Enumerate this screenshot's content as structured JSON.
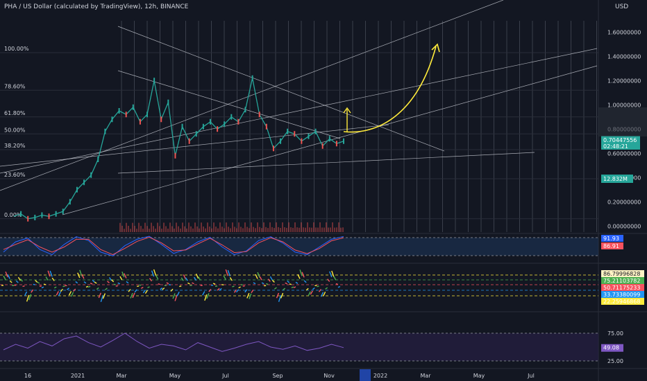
{
  "header": {
    "title": "PHA / US Dollar (calculated by TradingView), 12h, BINANCE",
    "currency": "USD"
  },
  "colors": {
    "background": "#131722",
    "grid": "#2a2e39",
    "fib_lines": "#b2b5be",
    "channel_lines": "#cfd2da",
    "projection": "#ffeb3b",
    "price_badge": "#26a69a",
    "volume_badge": "#26a69a",
    "stoch_k": "#2962ff",
    "stoch_d": "#f7525f",
    "rsi": "#7e57c2"
  },
  "chart_data": [
    {
      "type": "line",
      "panel": "price",
      "y_axis_ticks": [
        "1.60000000",
        "1.40000000",
        "1.20000000",
        "1.00000000",
        "0.80000000",
        "0.60000000",
        "0.40000000",
        "0.20000000",
        "0.00000000"
      ],
      "ylim": [
        -0.05,
        1.75
      ],
      "fib_levels": [
        {
          "label": "100.00%",
          "value": 1.43
        },
        {
          "label": "78.60%",
          "value": 1.12
        },
        {
          "label": "61.80%",
          "value": 0.9
        },
        {
          "label": "50.00%",
          "value": 0.76
        },
        {
          "label": "38.20%",
          "value": 0.63
        },
        {
          "label": "23.60%",
          "value": 0.39
        },
        {
          "label": "0.00%",
          "value": 0.06
        }
      ],
      "x_axis_labels": [
        "16",
        "2021",
        "Mar",
        "May",
        "Jul",
        "Sep",
        "Nov",
        "2022",
        "Mar",
        "May",
        "Jul"
      ],
      "series": [
        {
          "x": [
            0,
            1,
            2,
            3,
            4,
            5,
            6,
            7,
            8,
            9,
            10,
            11,
            12,
            13,
            14,
            15,
            16,
            17,
            18,
            19,
            20,
            21,
            22,
            23,
            24,
            25,
            26,
            27,
            28,
            29,
            30,
            31,
            32,
            33,
            34,
            35,
            36,
            37,
            38,
            39,
            40,
            41,
            42,
            43,
            44,
            45,
            46,
            47
          ],
          "values": [
            0.08,
            0.1,
            0.06,
            0.07,
            0.09,
            0.08,
            0.1,
            0.12,
            0.2,
            0.3,
            0.36,
            0.42,
            0.55,
            0.78,
            0.88,
            0.95,
            0.92,
            0.98,
            0.86,
            0.92,
            1.2,
            0.88,
            1.02,
            0.58,
            0.82,
            0.7,
            0.76,
            0.82,
            0.86,
            0.8,
            0.84,
            0.9,
            0.86,
            0.96,
            1.22,
            0.92,
            0.82,
            0.64,
            0.7,
            0.78,
            0.76,
            0.7,
            0.74,
            0.78,
            0.66,
            0.72,
            0.68,
            0.7
          ]
        }
      ],
      "current_price": "0.70447556",
      "countdown": "02:48:21",
      "volume_label": "12.832M"
    },
    {
      "type": "line",
      "panel": "stochastic",
      "values_labels": [
        "91.93",
        "86.91"
      ],
      "series": [
        {
          "values": [
            30,
            70,
            85,
            40,
            20,
            60,
            90,
            75,
            30,
            15,
            55,
            80,
            92,
            60,
            25,
            40,
            70,
            88,
            50,
            20,
            35,
            75,
            90,
            65,
            30,
            20,
            50,
            80,
            91
          ]
        },
        {
          "values": [
            40,
            60,
            78,
            50,
            30,
            50,
            80,
            80,
            40,
            20,
            45,
            72,
            88,
            66,
            35,
            38,
            62,
            84,
            58,
            28,
            32,
            66,
            86,
            70,
            38,
            24,
            44,
            74,
            86
          ]
        }
      ]
    },
    {
      "type": "line",
      "panel": "oscillator",
      "values_labels": [
        "86.79996828",
        "75.21103782",
        "50.71175233",
        "33.73380099",
        "22.25946868"
      ]
    },
    {
      "type": "line",
      "panel": "rsi",
      "y_axis_ticks": [
        "75.00",
        "25.00"
      ],
      "value_label": "49.08",
      "series": [
        {
          "values": [
            45,
            55,
            48,
            60,
            52,
            65,
            70,
            58,
            50,
            62,
            75,
            60,
            48,
            55,
            52,
            45,
            58,
            50,
            42,
            48,
            55,
            60,
            50,
            46,
            52,
            44,
            48,
            55,
            49
          ]
        }
      ]
    }
  ]
}
